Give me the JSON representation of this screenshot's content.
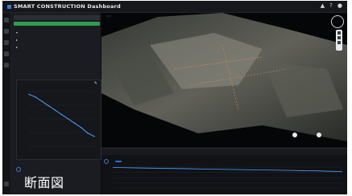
{
  "app": {
    "title": "SMART CONSTRUCTION Dashboard",
    "icons": [
      "notifications-icon",
      "help-icon",
      "user-avatar-icon"
    ]
  },
  "left_panel": {
    "search_text": "",
    "green_bar_text": "",
    "tree_items": [
      "",
      "",
      ""
    ],
    "profile_card": {
      "title": "",
      "footer": "",
      "chart_data": {
        "type": "line",
        "x": [
          0,
          1,
          2,
          3,
          4,
          5,
          6,
          7,
          8,
          9,
          10
        ],
        "y": [
          95,
          90,
          82,
          74,
          66,
          58,
          50,
          42,
          34,
          24,
          18
        ],
        "xlabel": "",
        "ylabel": "",
        "title": ""
      }
    },
    "toggle_text": ""
  },
  "viewer": {
    "label": ""
  },
  "tabs": [
    "",
    "",
    "",
    "",
    "",
    "",
    ""
  ],
  "bottom": {
    "control_label": "",
    "button_label": "",
    "chart_data": {
      "type": "line",
      "x": [
        0,
        1,
        2,
        3,
        4,
        5,
        6,
        7,
        8,
        9,
        10,
        11,
        12,
        13,
        14,
        15,
        16,
        17,
        18
      ],
      "y": [
        98,
        97,
        96,
        95,
        94,
        93,
        92,
        91,
        90,
        89,
        88,
        87,
        86,
        85,
        84,
        83,
        82,
        80,
        78
      ],
      "xlabel": "",
      "ylabel": "",
      "title": ""
    }
  },
  "caption": {
    "text": "断面図"
  }
}
